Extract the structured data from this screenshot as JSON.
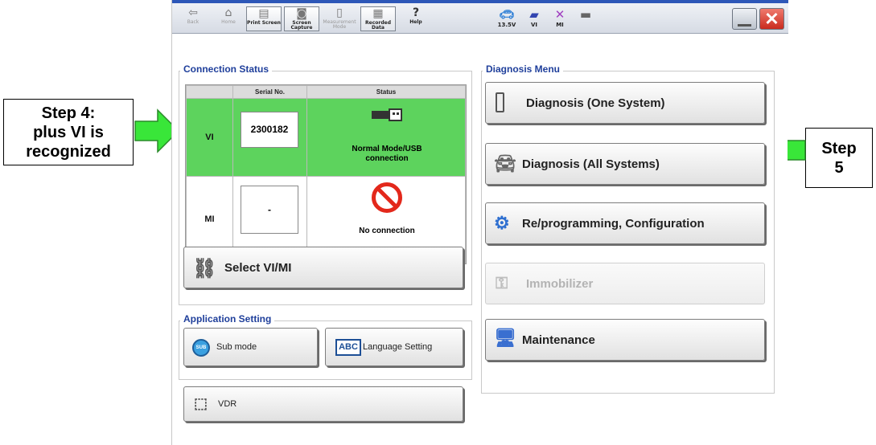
{
  "toolbar": {
    "back_label": "Back",
    "home_label": "Home",
    "print_screen_label": "Print Screen",
    "screen_capture_label": "Screen Capture",
    "measurement_mode_label": "Measurement Mode",
    "recorded_data_label": "Recorded Data",
    "help_label": "Help",
    "battery_voltage": "13.5V",
    "vi_label": "VI",
    "mi_label": "MI"
  },
  "connection_status": {
    "title": "Connection Status",
    "col_serial": "Serial No.",
    "col_status": "Status",
    "rows": [
      {
        "label": "VI",
        "serial": "2300182",
        "status": "Normal Mode/USB connection"
      },
      {
        "label": "MI",
        "serial": "-",
        "status": "No connection"
      }
    ]
  },
  "select_vi_mi_label": "Select VI/MI",
  "application_setting": {
    "title": "Application Setting",
    "sub_mode_label": "Sub mode",
    "sub_icon_text": "SUB",
    "language_setting_label": "Language Setting",
    "abc_icon_text": "ABC"
  },
  "vdr_label": "VDR",
  "diagnosis_menu": {
    "title": "Diagnosis Menu",
    "items": [
      "Diagnosis (One System)",
      "Diagnosis (All Systems)",
      "Re/programming, Configuration",
      "Immobilizer",
      "Maintenance"
    ]
  },
  "callouts": {
    "step4": [
      "Step 4:",
      "plus VI is",
      "recognized"
    ],
    "step5": [
      "Step",
      "5"
    ]
  },
  "colors": {
    "accent_title": "#1f3f9b",
    "status_ok_green": "#5dd35d",
    "callout_arrow_green": "#39e639",
    "close_red": "#e23b2e"
  }
}
